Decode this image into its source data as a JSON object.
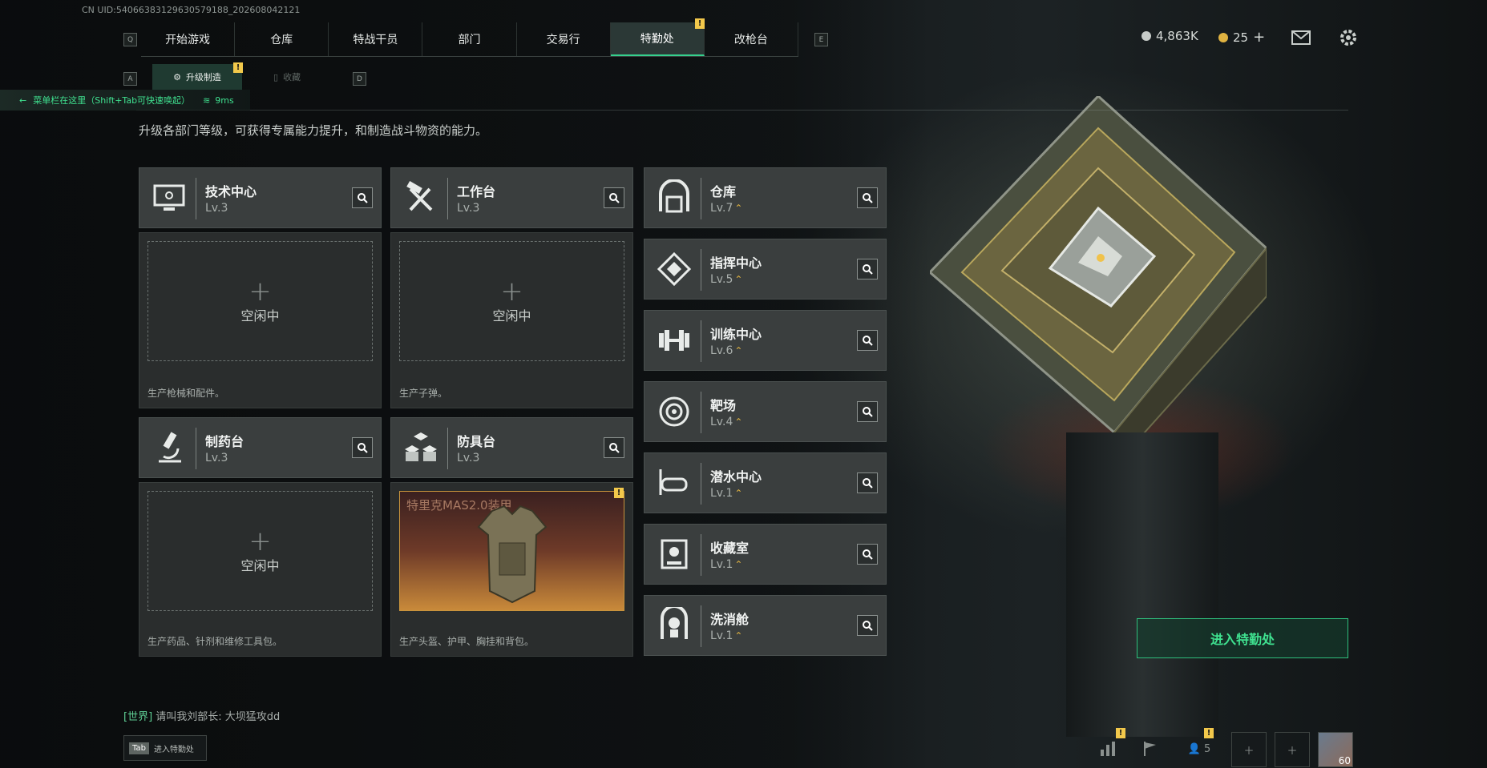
{
  "uid": "CN UID:54066383129630579188_202608042121",
  "nav": {
    "key_left": "Q",
    "key_right": "E",
    "tabs": [
      "开始游戏",
      "仓库",
      "特战干员",
      "部门",
      "交易行",
      "特勤处",
      "改枪台"
    ],
    "active_index": 5,
    "alert_mark": "!"
  },
  "subnav": {
    "key_left": "A",
    "key_right": "D",
    "tabs": [
      "升级制造",
      "收藏"
    ],
    "active_index": 0
  },
  "currencies": [
    {
      "value": "4,863K",
      "color": "#c7ccc9"
    },
    {
      "value": "25",
      "color": "#e0b341",
      "plus": "+"
    }
  ],
  "hint": {
    "text": "菜单栏在这里（Shift+Tab可快速唤起）",
    "ping": "9ms"
  },
  "description": "升级各部门等级，可获得专属能力提升，和制造战斗物资的能力。",
  "production": [
    {
      "name": "技术中心",
      "level": "Lv.3",
      "icon": "computer-icon",
      "slot": "空闲中",
      "footer": "生产枪械和配件。"
    },
    {
      "name": "工作台",
      "level": "Lv.3",
      "icon": "tools-icon",
      "slot": "空闲中",
      "footer": "生产子弹。"
    },
    {
      "name": "制药台",
      "level": "Lv.3",
      "icon": "microscope-icon",
      "slot": "空闲中",
      "footer": "生产药品、针剂和维修工具包。"
    },
    {
      "name": "防具台",
      "level": "Lv.3",
      "icon": "cubes-icon",
      "item": "特里克MAS2.0装甲",
      "footer": "生产头盔、护甲、胸挂和背包。"
    }
  ],
  "departments": [
    {
      "name": "仓库",
      "level": "Lv.7",
      "icon": "warehouse-icon"
    },
    {
      "name": "指挥中心",
      "level": "Lv.5",
      "icon": "command-icon"
    },
    {
      "name": "训练中心",
      "level": "Lv.6",
      "icon": "dumbbell-icon"
    },
    {
      "name": "靶场",
      "level": "Lv.4",
      "icon": "target-icon"
    },
    {
      "name": "潜水中心",
      "level": "Lv.1",
      "icon": "diving-mask-icon"
    },
    {
      "name": "收藏室",
      "level": "Lv.1",
      "icon": "display-case-icon"
    },
    {
      "name": "洗消舱",
      "level": "Lv.1",
      "icon": "hazmat-icon"
    }
  ],
  "enter_button": "进入特勤处",
  "chat": {
    "channel": "[世界]",
    "message": "请叫我刘部长: 大坝猛攻dd"
  },
  "tab_hint": {
    "key": "Tab",
    "label": "进入特勤处"
  },
  "bottom_bar": {
    "friends": "5",
    "level": "60"
  }
}
